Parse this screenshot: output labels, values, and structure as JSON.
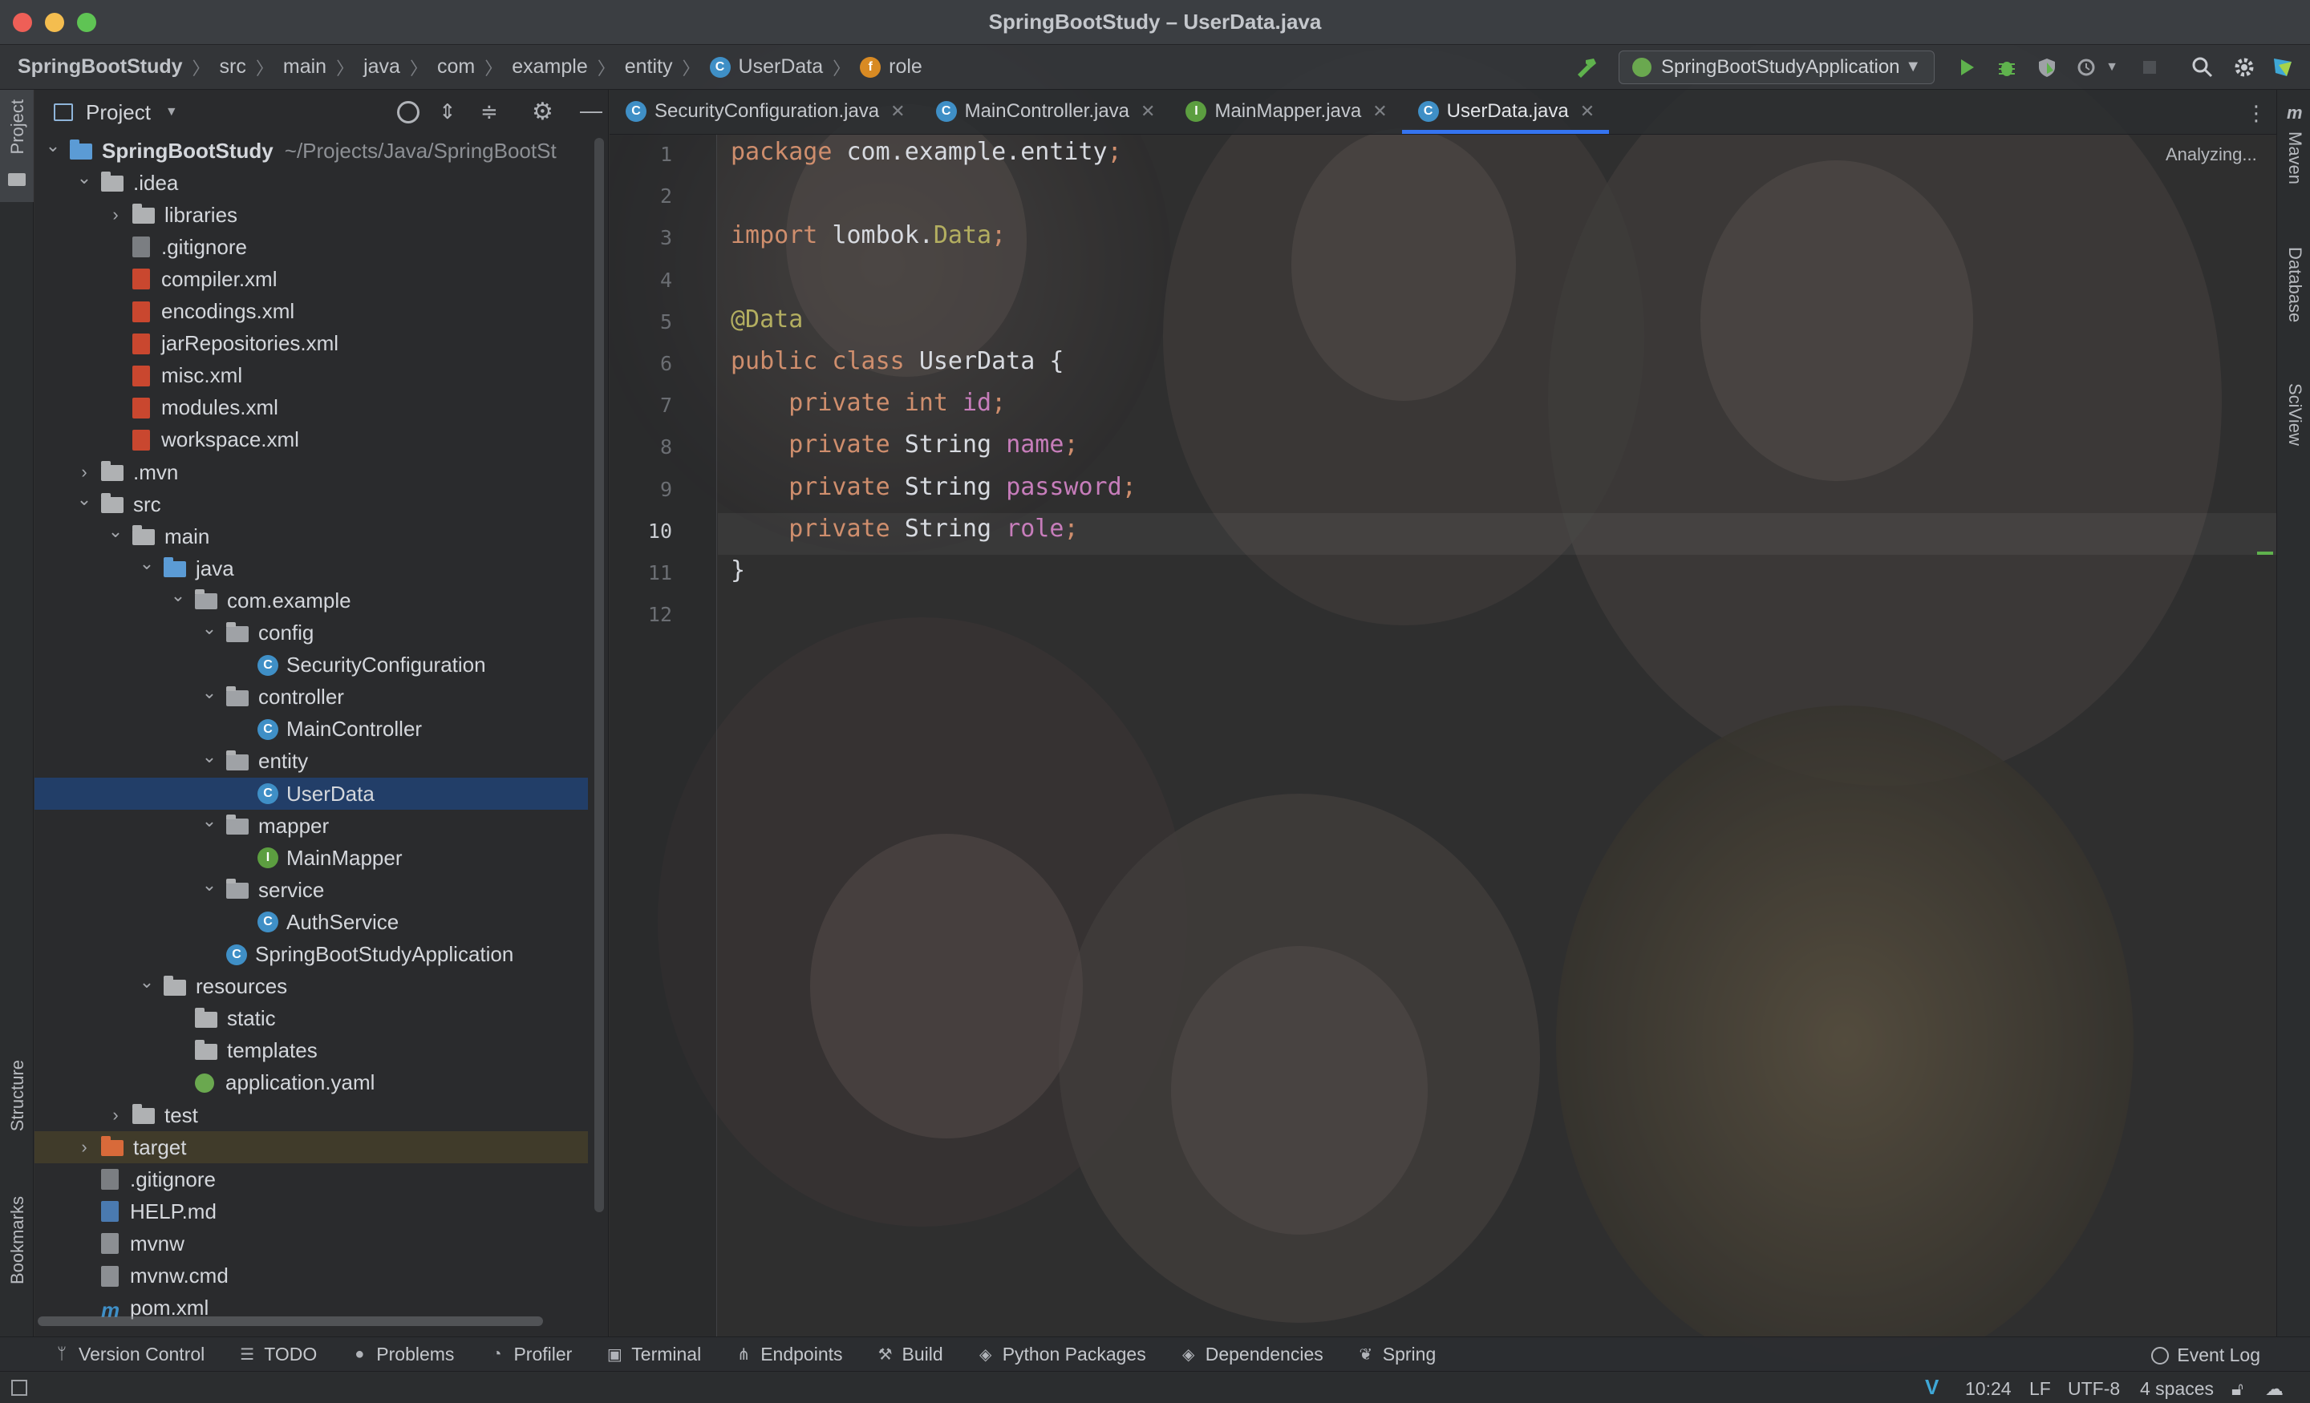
{
  "window": {
    "title": "SpringBootStudy – UserData.java"
  },
  "breadcrumb": {
    "items": [
      "SpringBootStudy",
      "src",
      "main",
      "java",
      "com",
      "example",
      "entity",
      "UserData",
      "role"
    ]
  },
  "run_config": {
    "label": "SpringBootStudyApplication"
  },
  "side_tools": {
    "left_top": "Project",
    "left_structure": "Structure",
    "left_bookmarks": "Bookmarks",
    "right": [
      "Maven",
      "Database",
      "SciView"
    ]
  },
  "project_panel": {
    "title": "Project",
    "tree": [
      {
        "label": "SpringBootStudy",
        "extra": "~/Projects/Java/SpringBootSt",
        "depth": 0,
        "expanded": "open",
        "icon": "module-folder"
      },
      {
        "label": ".idea",
        "depth": 1,
        "expanded": "open",
        "icon": "folder"
      },
      {
        "label": "libraries",
        "depth": 2,
        "expanded": "closed",
        "icon": "folder"
      },
      {
        "label": ".gitignore",
        "depth": 2,
        "icon": "gitignore-file"
      },
      {
        "label": "compiler.xml",
        "depth": 2,
        "icon": "xml-file"
      },
      {
        "label": "encodings.xml",
        "depth": 2,
        "icon": "xml-file"
      },
      {
        "label": "jarRepositories.xml",
        "depth": 2,
        "icon": "xml-file"
      },
      {
        "label": "misc.xml",
        "depth": 2,
        "icon": "xml-file"
      },
      {
        "label": "modules.xml",
        "depth": 2,
        "icon": "xml-file"
      },
      {
        "label": "workspace.xml",
        "depth": 2,
        "icon": "xml-file"
      },
      {
        "label": ".mvn",
        "depth": 1,
        "expanded": "closed",
        "icon": "folder"
      },
      {
        "label": "src",
        "depth": 1,
        "expanded": "open",
        "icon": "folder"
      },
      {
        "label": "main",
        "depth": 2,
        "expanded": "open",
        "icon": "folder"
      },
      {
        "label": "java",
        "depth": 3,
        "expanded": "open",
        "icon": "source-folder"
      },
      {
        "label": "com.example",
        "depth": 4,
        "expanded": "open",
        "icon": "package"
      },
      {
        "label": "config",
        "depth": 5,
        "expanded": "open",
        "icon": "package"
      },
      {
        "label": "SecurityConfiguration",
        "depth": 6,
        "icon": "class"
      },
      {
        "label": "controller",
        "depth": 5,
        "expanded": "open",
        "icon": "package"
      },
      {
        "label": "MainController",
        "depth": 6,
        "icon": "class"
      },
      {
        "label": "entity",
        "depth": 5,
        "expanded": "open",
        "icon": "package"
      },
      {
        "label": "UserData",
        "depth": 6,
        "icon": "class",
        "selected": true
      },
      {
        "label": "mapper",
        "depth": 5,
        "expanded": "open",
        "icon": "package"
      },
      {
        "label": "MainMapper",
        "depth": 6,
        "icon": "interface"
      },
      {
        "label": "service",
        "depth": 5,
        "expanded": "open",
        "icon": "package"
      },
      {
        "label": "AuthService",
        "depth": 6,
        "icon": "class"
      },
      {
        "label": "SpringBootStudyApplication",
        "depth": 5,
        "icon": "spring-class"
      },
      {
        "label": "resources",
        "depth": 3,
        "expanded": "open",
        "icon": "resources-folder"
      },
      {
        "label": "static",
        "depth": 4,
        "icon": "folder"
      },
      {
        "label": "templates",
        "depth": 4,
        "icon": "folder"
      },
      {
        "label": "application.yaml",
        "depth": 4,
        "icon": "yaml-file"
      },
      {
        "label": "test",
        "depth": 2,
        "expanded": "closed",
        "icon": "folder"
      },
      {
        "label": "target",
        "depth": 1,
        "expanded": "closed",
        "icon": "excluded-folder",
        "highlighted": true
      },
      {
        "label": ".gitignore",
        "depth": 1,
        "icon": "gitignore-file"
      },
      {
        "label": "HELP.md",
        "depth": 1,
        "icon": "markdown-file"
      },
      {
        "label": "mvnw",
        "depth": 1,
        "icon": "script-file"
      },
      {
        "label": "mvnw.cmd",
        "depth": 1,
        "icon": "script-file"
      },
      {
        "label": "pom.xml",
        "depth": 1,
        "icon": "maven-file"
      }
    ]
  },
  "tabs": [
    {
      "label": "SecurityConfiguration.java",
      "icon": "class",
      "active": false
    },
    {
      "label": "MainController.java",
      "icon": "class",
      "active": false
    },
    {
      "label": "MainMapper.java",
      "icon": "interface",
      "active": false
    },
    {
      "label": "UserData.java",
      "icon": "class",
      "active": true
    }
  ],
  "editor": {
    "status": "Analyzing...",
    "current_line": 10,
    "lines": [
      [
        {
          "t": "package ",
          "c": "kw"
        },
        {
          "t": "com.example.entity",
          "c": ""
        },
        {
          "t": ";",
          "c": "sem"
        }
      ],
      [],
      [
        {
          "t": "import ",
          "c": "kw"
        },
        {
          "t": "lombok.",
          "c": ""
        },
        {
          "t": "Data",
          "c": "an"
        },
        {
          "t": ";",
          "c": "sem"
        }
      ],
      [],
      [
        {
          "t": "@Data",
          "c": "an"
        }
      ],
      [
        {
          "t": "public class ",
          "c": "kw"
        },
        {
          "t": "UserData {",
          "c": ""
        }
      ],
      [
        {
          "t": "    private int ",
          "c": "kw"
        },
        {
          "t": "id",
          "c": "fld"
        },
        {
          "t": ";",
          "c": "sem"
        }
      ],
      [
        {
          "t": "    private ",
          "c": "kw"
        },
        {
          "t": "String ",
          "c": ""
        },
        {
          "t": "name",
          "c": "fld"
        },
        {
          "t": ";",
          "c": "sem"
        }
      ],
      [
        {
          "t": "    private ",
          "c": "kw"
        },
        {
          "t": "String ",
          "c": ""
        },
        {
          "t": "password",
          "c": "fld"
        },
        {
          "t": ";",
          "c": "sem"
        }
      ],
      [
        {
          "t": "    private ",
          "c": "kw"
        },
        {
          "t": "String ",
          "c": ""
        },
        {
          "t": "role",
          "c": "fld"
        },
        {
          "t": ";",
          "c": "sem"
        }
      ],
      [
        {
          "t": "}",
          "c": ""
        }
      ],
      []
    ]
  },
  "tool_windows": [
    "Version Control",
    "TODO",
    "Problems",
    "Profiler",
    "Terminal",
    "Endpoints",
    "Build",
    "Python Packages",
    "Dependencies",
    "Spring"
  ],
  "event_log": "Event Log",
  "status": {
    "position": "10:24",
    "line_sep": "LF",
    "encoding": "UTF-8",
    "indent": "4 spaces"
  },
  "colors": {
    "accent": "#3574f0",
    "keyword": "#cf8e6d",
    "annotation": "#b3ae60",
    "field": "#c77dbb",
    "selection": "#214273"
  }
}
